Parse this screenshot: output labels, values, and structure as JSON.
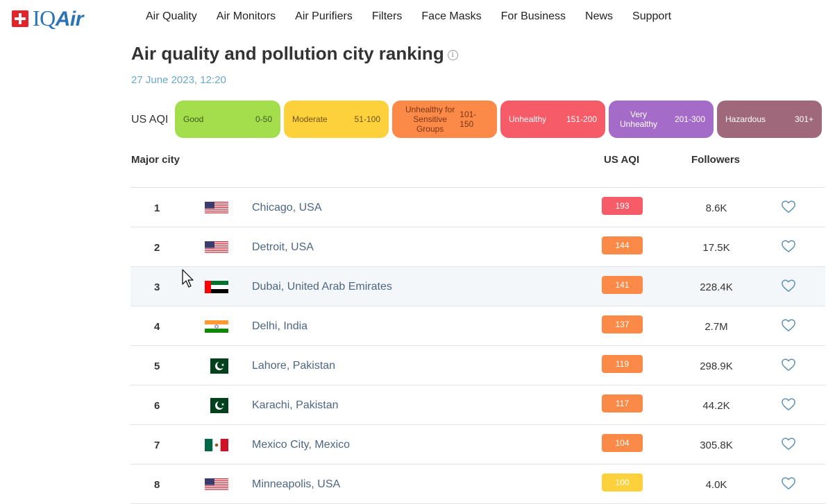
{
  "header": {
    "brand_prefix": "IQ",
    "brand_suffix": "Air",
    "nav": [
      "Air Quality",
      "Air Monitors",
      "Air Purifiers",
      "Filters",
      "Face Masks",
      "For Business",
      "News",
      "Support"
    ]
  },
  "page": {
    "title": "Air quality and pollution city ranking",
    "info_icon_glyph": "i",
    "date": "27 June 2023, 12:20"
  },
  "legend": {
    "label": "US AQI",
    "levels": [
      {
        "name": "Good",
        "range": "0-50",
        "color": "#a4de4d"
      },
      {
        "name": "Moderate",
        "range": "51-100",
        "color": "#fdd13c"
      },
      {
        "name": "Unhealthy for Sensitive Groups",
        "range": "101-150",
        "color": "#fb8a49"
      },
      {
        "name": "Unhealthy",
        "range": "151-200",
        "color": "#f65b68"
      },
      {
        "name": "Very Unhealthy",
        "range": "201-300",
        "color": "#a56bc8"
      },
      {
        "name": "Hazardous",
        "range": "301+",
        "color": "#a0697b"
      }
    ]
  },
  "table": {
    "headers": {
      "city": "Major city",
      "aqi": "US AQI",
      "followers": "Followers"
    },
    "rows": [
      {
        "rank": "1",
        "flag": "usa",
        "city": "Chicago, USA",
        "aqi": "193",
        "aqi_color": "#f65b68",
        "followers": "8.6K"
      },
      {
        "rank": "2",
        "flag": "usa",
        "city": "Detroit, USA",
        "aqi": "144",
        "aqi_color": "#fb8a49",
        "followers": "17.5K"
      },
      {
        "rank": "3",
        "flag": "uae",
        "city": "Dubai, United Arab Emirates",
        "aqi": "141",
        "aqi_color": "#fb8a49",
        "followers": "228.4K"
      },
      {
        "rank": "4",
        "flag": "india",
        "city": "Delhi, India",
        "aqi": "137",
        "aqi_color": "#fb8a49",
        "followers": "2.7M"
      },
      {
        "rank": "5",
        "flag": "pakistan",
        "city": "Lahore, Pakistan",
        "aqi": "119",
        "aqi_color": "#fb8a49",
        "followers": "298.9K"
      },
      {
        "rank": "6",
        "flag": "pakistan",
        "city": "Karachi, Pakistan",
        "aqi": "117",
        "aqi_color": "#fb8a49",
        "followers": "44.2K"
      },
      {
        "rank": "7",
        "flag": "mexico",
        "city": "Mexico City, Mexico",
        "aqi": "104",
        "aqi_color": "#fb8a49",
        "followers": "305.8K"
      },
      {
        "rank": "8",
        "flag": "usa",
        "city": "Minneapolis, USA",
        "aqi": "100",
        "aqi_color": "#fdd13c",
        "followers": "4.0K"
      }
    ]
  }
}
